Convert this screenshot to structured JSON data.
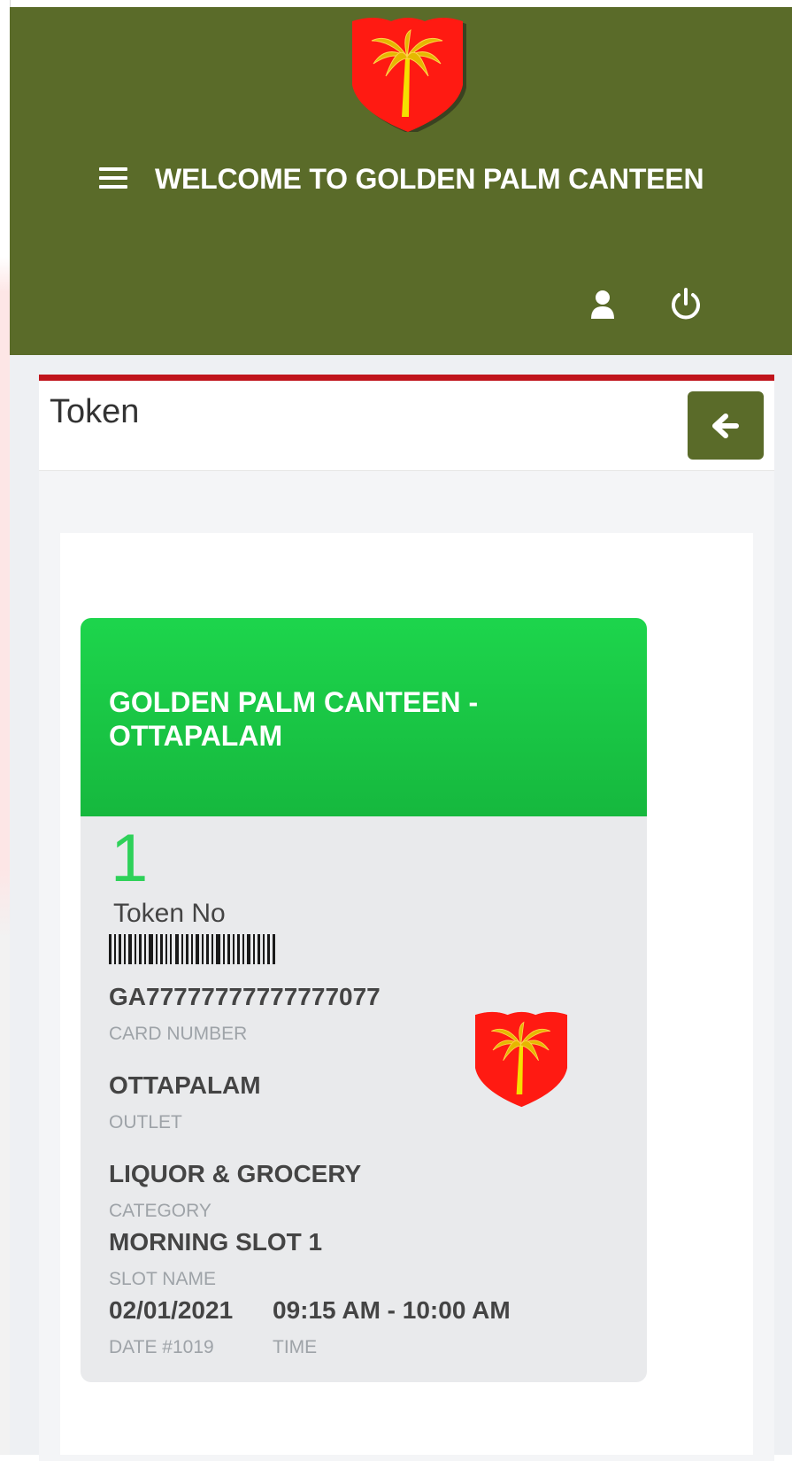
{
  "header": {
    "title": "WELCOME TO GOLDEN PALM CANTEEN",
    "logo_icon": "palm-shield-logo",
    "menu_icon": "hamburger-menu-icon",
    "user_icon": "user-icon",
    "power_icon": "power-icon",
    "brand_color": "#5a6b29"
  },
  "panel": {
    "title": "Token",
    "back_icon": "arrow-left-icon",
    "accent_color": "#c0141b"
  },
  "token_card": {
    "outlet_title": "GOLDEN PALM CANTEEN - OTTAPALAM",
    "token_number": "1",
    "token_label": "Token No",
    "card_number": "GA77777777777777077",
    "card_number_label": "CARD NUMBER",
    "outlet": "OTTAPALAM",
    "outlet_label": "OUTLET",
    "category": "LIQUOR & GROCERY",
    "category_label": "CATEGORY",
    "slot_name": "MORNING SLOT 1",
    "slot_name_label": "SLOT NAME",
    "date": "02/01/2021",
    "date_label": "DATE #1019",
    "time": "09:15 AM - 10:00 AM",
    "time_label": "TIME",
    "header_color": "#1dd54c",
    "token_color": "#2ed159"
  }
}
